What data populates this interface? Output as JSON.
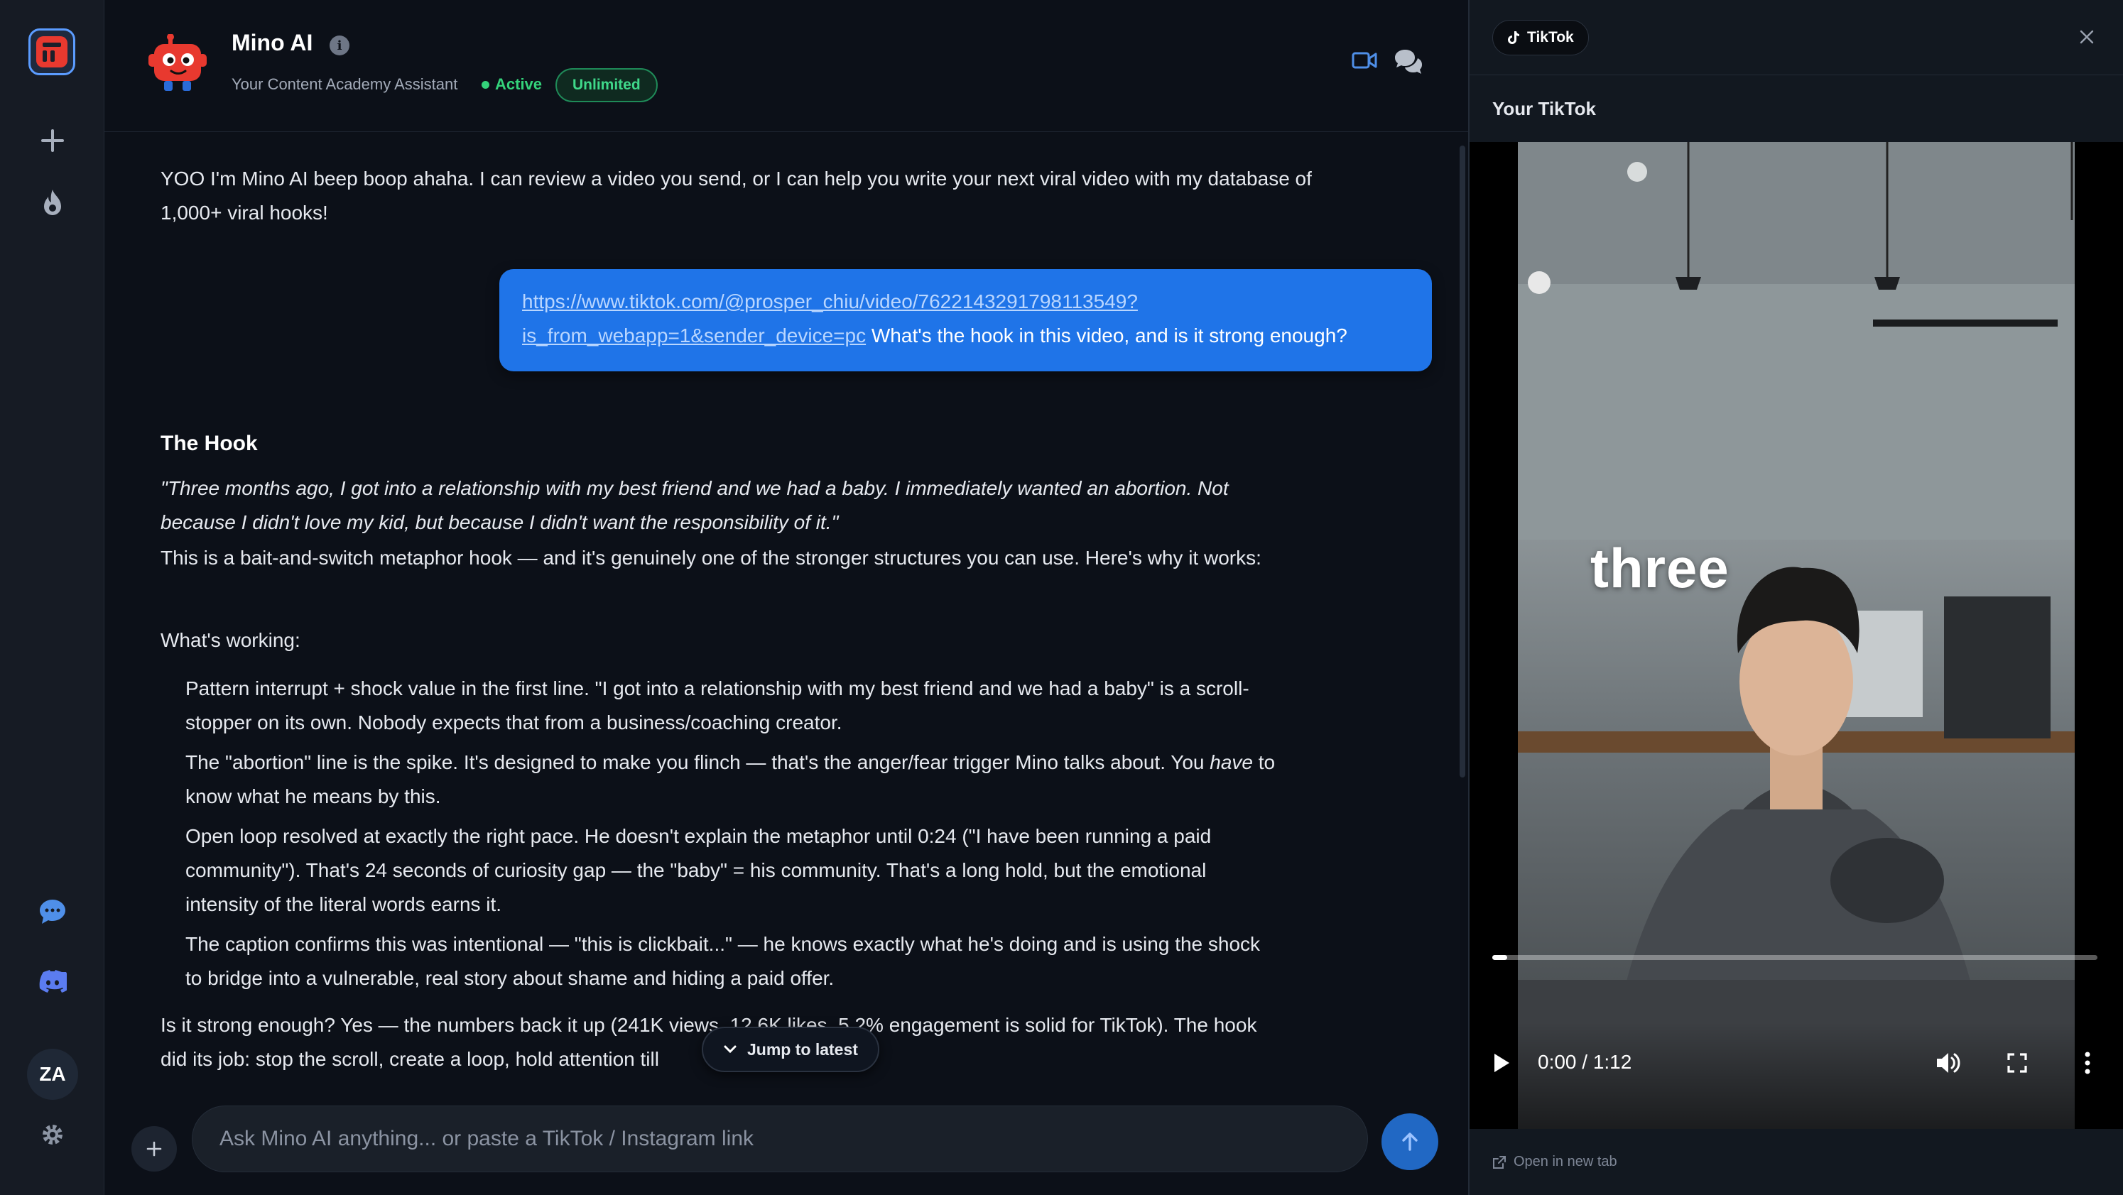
{
  "bot": {
    "name": "Mino AI",
    "subtitle": "Your Content Academy Assistant",
    "status": "Active",
    "badge": "Unlimited"
  },
  "user": {
    "initials": "ZA"
  },
  "messages": {
    "welcome": "YOO I'm Mino AI beep boop ahaha. I can review a video you send, or I can help you write your next viral video with my database of 1,000+ viral hooks!",
    "user_link": "https://www.tiktok.com/@prosper_chiu/video/7622143291798113549?is_from_webapp=1&sender_device=pc",
    "user_question": " What's the hook in this video, and is it strong enough?",
    "hook_heading": "The Hook",
    "quote": "\"Three months ago, I got into a relationship with my best friend and we had a baby. I immediately wanted an abortion. Not because I didn't love my kid, but because I didn't want the responsibility of it.\"",
    "para1": "This is a bait-and-switch metaphor hook — and it's genuinely one of the stronger structures you can use. Here's why it works:",
    "working_heading": "What's working:",
    "bullet1": "Pattern interrupt + shock value in the first line. \"I got into a relationship with my best friend and we had a baby\" is a scroll-stopper on its own. Nobody expects that from a business/coaching creator.",
    "bullet2_a": "The \"abortion\" line is the spike. It's designed to make you flinch — that's the anger/fear trigger Mino talks about. You ",
    "bullet2_em": "have",
    "bullet2_b": " to know what he means by this.",
    "bullet3": "Open loop resolved at exactly the right pace. He doesn't explain the metaphor until 0:24 (\"I have been running a paid community\"). That's 24 seconds of curiosity gap — the \"baby\" = his community. That's a long hold, but the emotional intensity of the literal words earns it.",
    "bullet4": "The caption confirms this was intentional — \"this is clickbait...\" — he knows exactly what he's doing and is using the shock to bridge into a vulnerable, real story about shame and hiding a paid offer.",
    "verdict": "Is it strong enough? Yes — the numbers back it up (241K views, 12.6K likes, 5.2% engagement is solid for TikTok). The hook did its job: stop the scroll, create a loop, hold attention till"
  },
  "jump_label": "Jump to latest",
  "composer": {
    "placeholder": "Ask Mino AI anything... or paste a TikTok / Instagram link"
  },
  "panel": {
    "chip": "TikTok",
    "title": "Your TikTok",
    "caption": "three",
    "time": "0:00 / 1:12",
    "progress_fraction": 0.025,
    "open_tab": "Open in new tab"
  },
  "colors": {
    "accent": "#1f74e8",
    "active": "#34d27a",
    "brand": "#e8392f"
  }
}
